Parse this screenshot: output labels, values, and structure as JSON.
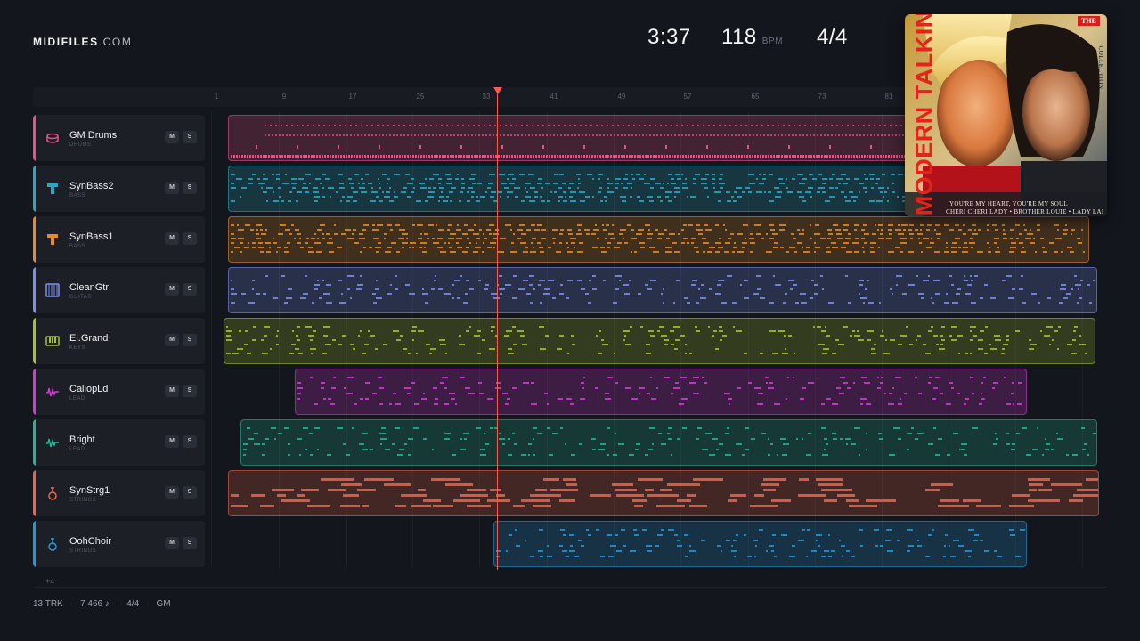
{
  "brand": {
    "name": "MIDIFILES",
    "tld": ".COM"
  },
  "stats": {
    "time": "3:37",
    "bpm": "118",
    "bpm_unit": "BPM",
    "signature": "4/4"
  },
  "ruler": {
    "ticks": [
      "1",
      "9",
      "17",
      "25",
      "33",
      "41",
      "49",
      "57",
      "65",
      "73",
      "81"
    ]
  },
  "tracks": [
    {
      "name": "GM Drums",
      "category": "DRUMS",
      "icon": "drum-icon",
      "color": "#e8508a",
      "mute": "M",
      "solo": "S"
    },
    {
      "name": "SynBass2",
      "category": "BASS",
      "icon": "bass-icon",
      "color": "#29a8c4",
      "mute": "M",
      "solo": "S"
    },
    {
      "name": "SynBass1",
      "category": "BASS",
      "icon": "bass-icon",
      "color": "#e98a27",
      "mute": "M",
      "solo": "S"
    },
    {
      "name": "CleanGtr",
      "category": "GUITAR",
      "icon": "guitar-icon",
      "color": "#7d8ef0",
      "mute": "M",
      "solo": "S"
    },
    {
      "name": "El.Grand",
      "category": "KEYS",
      "icon": "keys-icon",
      "color": "#a7c22a",
      "mute": "M",
      "solo": "S"
    },
    {
      "name": "CaliopLd",
      "category": "LEAD",
      "icon": "wave-icon",
      "color": "#d638d6",
      "mute": "M",
      "solo": "S"
    },
    {
      "name": "Bright",
      "category": "LEAD",
      "icon": "wave-icon",
      "color": "#23b596",
      "mute": "M",
      "solo": "S"
    },
    {
      "name": "SynStrg1",
      "category": "STRINGS",
      "icon": "violin-icon",
      "color": "#f0634a",
      "mute": "M",
      "solo": "S"
    },
    {
      "name": "OohChoir",
      "category": "STRINGS",
      "icon": "violin-icon",
      "color": "#2696d6",
      "mute": "M",
      "solo": "S"
    }
  ],
  "more_tracks": "+4",
  "footer": {
    "tracks": "13 TRK",
    "notes": "7 466 ♪",
    "signature": "4/4",
    "standard": "GM"
  },
  "cover": {
    "artist": "MODERN TALKING",
    "badge": "THE",
    "side": "COLLECTION",
    "line1": "YOU'RE MY HEART, YOU'RE MY SOUL",
    "line2": "CHERI CHERI LADY • BROTHER LOUIE • LADY LAI"
  }
}
